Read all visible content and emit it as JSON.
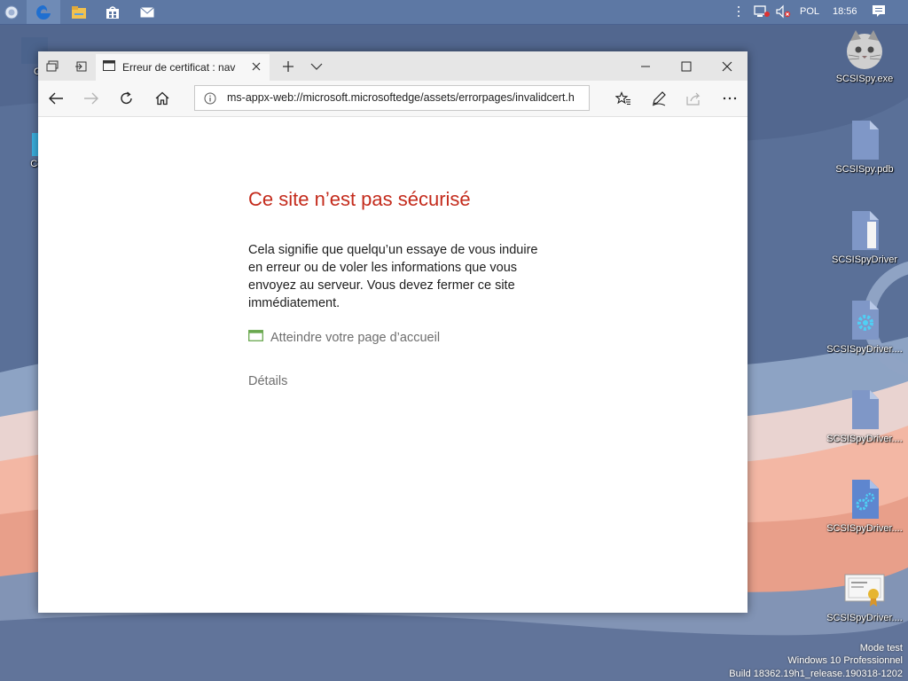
{
  "taskbar": {
    "language": "POL",
    "time": "18:56",
    "icons": [
      "shield-icon",
      "edge-icon",
      "file-explorer-icon",
      "store-icon",
      "mail-icon"
    ],
    "tray_icons": [
      "chevron-up-icon",
      "network-icon",
      "volume-muted-icon",
      "notification-icon"
    ]
  },
  "desktop": {
    "left_icons": [
      {
        "label": "Ce",
        "icon": "generic-icon"
      },
      {
        "label": "Cor",
        "icon": "generic-icon"
      }
    ],
    "right_icons": [
      {
        "label": "SCSISpy.exe",
        "icon": "cat-app-icon"
      },
      {
        "label": "SCSISpy.pdb",
        "icon": "file-icon"
      },
      {
        "label": "SCSISpyDriver",
        "icon": "file-icon"
      },
      {
        "label": "SCSISpyDriver....",
        "icon": "gear-file-icon"
      },
      {
        "label": "SCSISpyDriver....",
        "icon": "file-icon"
      },
      {
        "label": "SCSISpyDriver....",
        "icon": "gears-file-icon"
      },
      {
        "label": "SCSISpyDriver....",
        "icon": "certificate-icon"
      }
    ],
    "watermark": {
      "line1": "Mode test",
      "line2": "Windows 10 Professionnel",
      "line3": "Build 18362.19h1_release.190318-1202"
    }
  },
  "browser": {
    "tab_title": "Erreur de certificat : nav",
    "address": "ms-appx-web://microsoft.microsoftedge/assets/errorpages/invalidcert.h",
    "page": {
      "title": "Ce site n’est pas sécurisé",
      "body": "Cela signifie que quelqu’un essaye de vous induire en erreur ou de voler les informations que vous envoyez au serveur. Vous devez fermer ce site immédiatement.",
      "home_link": "Atteindre votre page d’accueil",
      "details": "Détails"
    },
    "colors": {
      "title_red": "#c42b1c",
      "link_green": "#6aa84f"
    }
  }
}
